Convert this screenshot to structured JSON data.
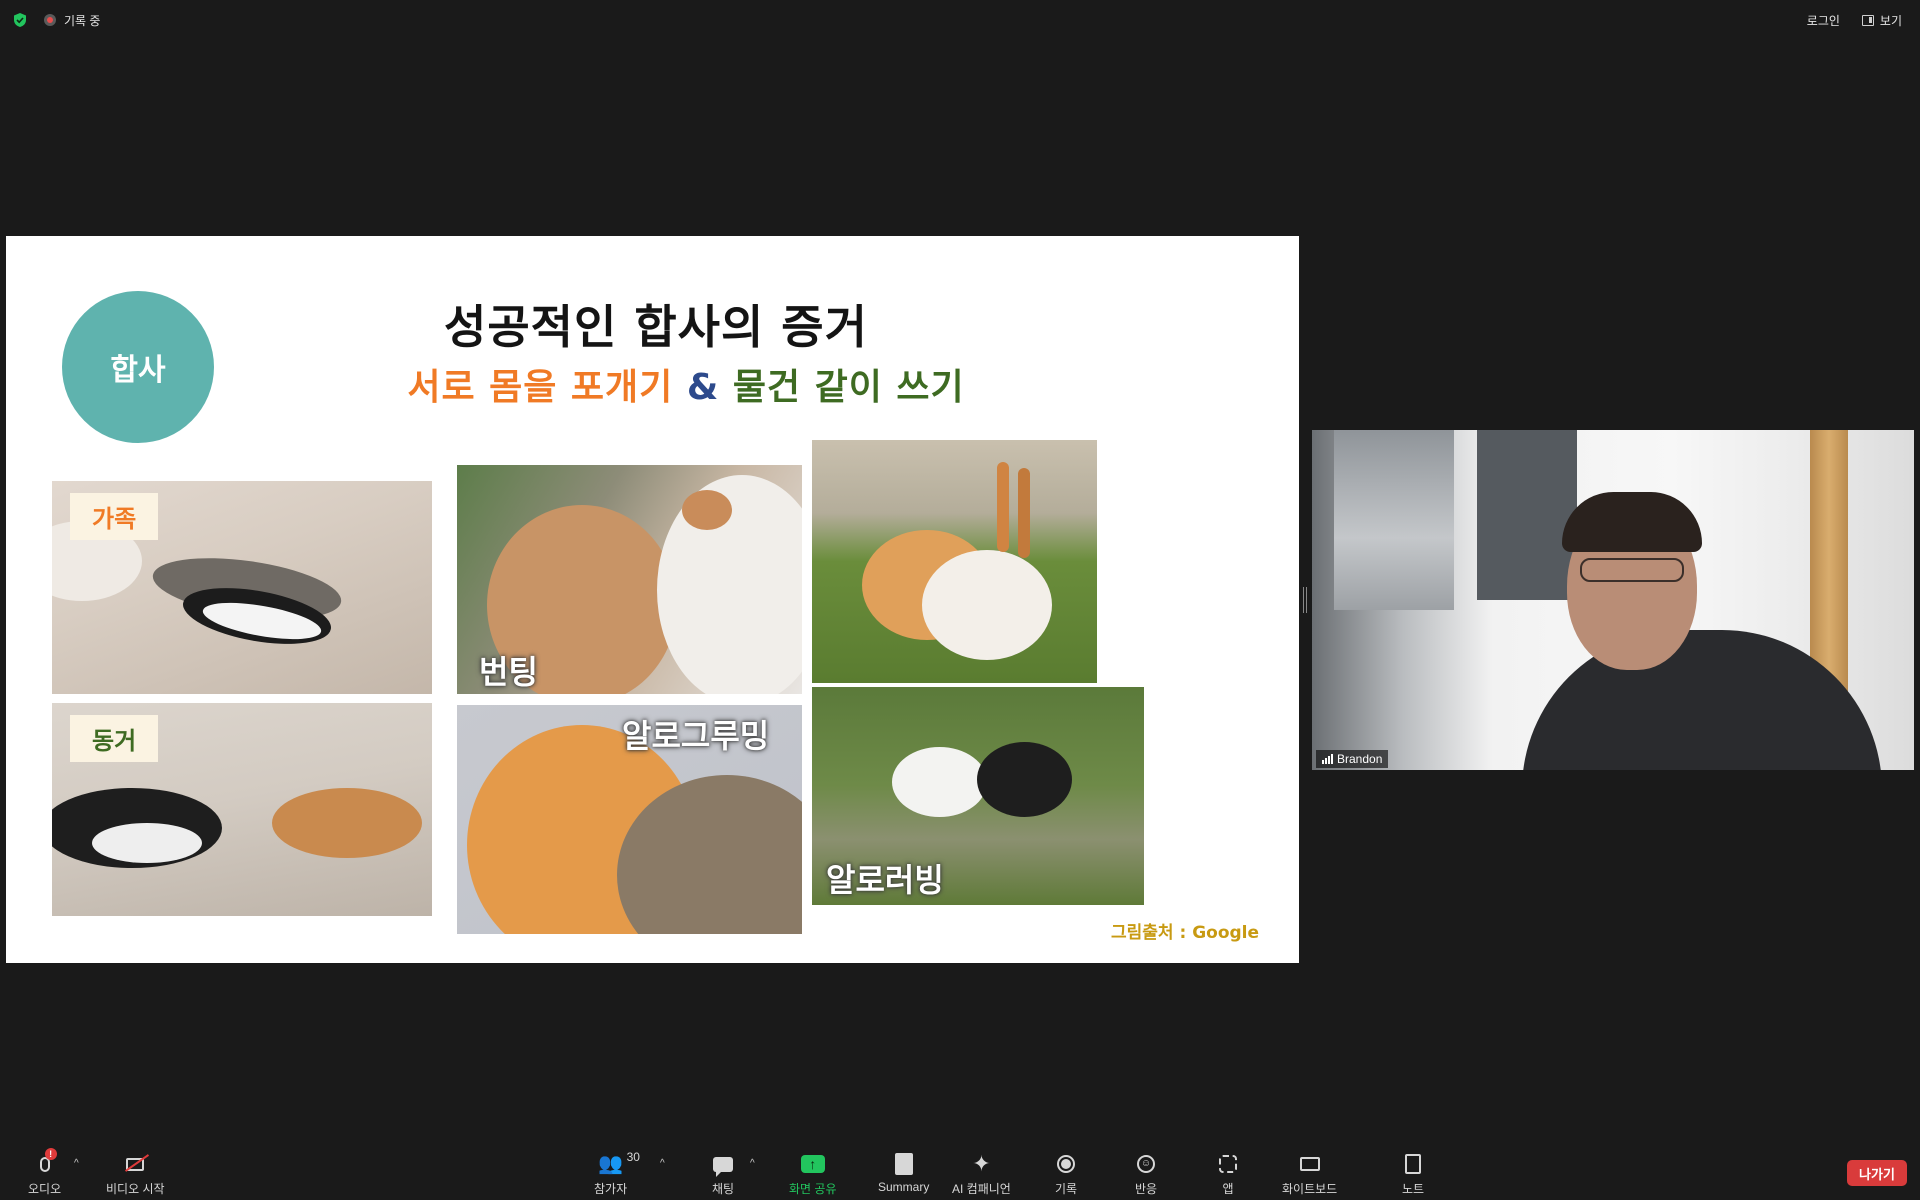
{
  "topbar": {
    "recording_label": "기록 중",
    "login_label": "로그인",
    "view_label": "보기"
  },
  "slide": {
    "badge": "합사",
    "title": "성공적인 합사의 증거",
    "subtitle_part1": "서로 몸을 포개기",
    "subtitle_amp": "&",
    "subtitle_part2": "물건 같이 쓰기",
    "photos": [
      {
        "label": "가족"
      },
      {
        "label": "동거"
      },
      {
        "label": "번팅"
      },
      {
        "label": "알로그루밍"
      },
      {
        "label": ""
      },
      {
        "label": "알로러빙"
      }
    ],
    "credit": "그림출처 : Google",
    "colors": {
      "badge": "#5fb3ae",
      "orange": "#f07a25",
      "navy": "#2d4a8c",
      "green": "#3e6b22",
      "credit": "#c89a12"
    }
  },
  "video": {
    "participant_name": "Brandon"
  },
  "toolbar": {
    "audio": {
      "label": "오디오",
      "badge": "!",
      "icon": "microphone-icon"
    },
    "video": {
      "label": "비디오 시작",
      "icon": "video-off-icon"
    },
    "participants": {
      "label": "참가자",
      "count": "30",
      "icon": "people-icon"
    },
    "chat": {
      "label": "채팅",
      "icon": "chat-icon"
    },
    "share": {
      "label": "화면 공유",
      "icon": "share-screen-icon",
      "color": "#22c55e"
    },
    "summary": {
      "label": "Summary",
      "icon": "summary-icon"
    },
    "ai": {
      "label": "AI 컴패니언",
      "icon": "sparkle-icon"
    },
    "record": {
      "label": "기록",
      "icon": "record-icon"
    },
    "reactions": {
      "label": "반응",
      "icon": "reaction-icon"
    },
    "apps": {
      "label": "앱",
      "icon": "apps-icon"
    },
    "whiteboard": {
      "label": "화이트보드",
      "icon": "whiteboard-icon"
    },
    "notes": {
      "label": "노트",
      "icon": "notes-icon"
    },
    "leave": {
      "label": "나가기",
      "color": "#d93b3b"
    }
  }
}
